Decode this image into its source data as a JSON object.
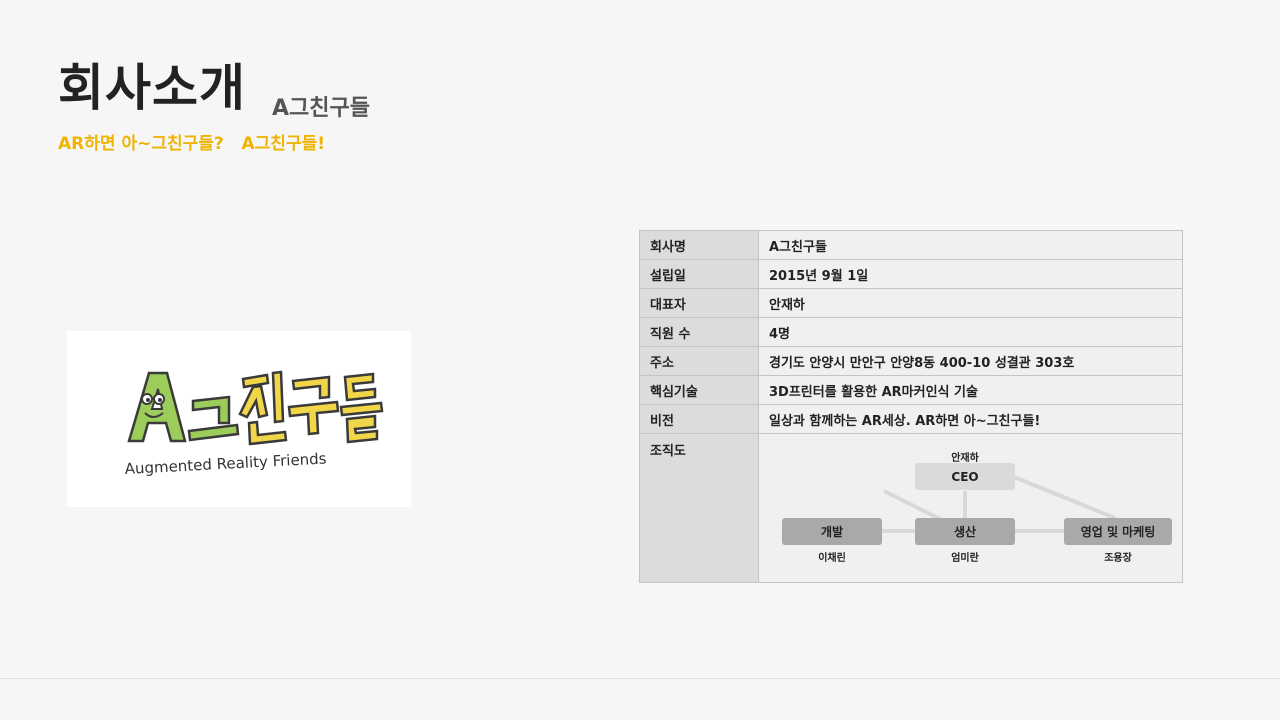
{
  "header": {
    "title": "회사소개",
    "subtitle": "A그친구들",
    "tagline": "AR하면 아~그친구들?   A그친구들!"
  },
  "logo": {
    "main_text": "A그친구들",
    "caption": "Augmented Reality Friends",
    "colors": {
      "green": "#9ccc5a",
      "yellow": "#f1d64a",
      "outline": "#3a3a3a"
    }
  },
  "company_info": {
    "rows": [
      {
        "label": "회사명",
        "value": "A그친구들"
      },
      {
        "label": "설립일",
        "value": "2015년 9월 1일"
      },
      {
        "label": "대표자",
        "value": "안재하"
      },
      {
        "label": "직원 수",
        "value": "4명"
      },
      {
        "label": "주소",
        "value": "경기도 안양시 만안구 안양8동 400-10 성결관 303호"
      },
      {
        "label": "핵심기술",
        "value": "3D프린터를 활용한 AR마커인식 기술"
      },
      {
        "label": "비전",
        "value": "일상과 함께하는 AR세상. AR하면 아~그친구들!"
      }
    ],
    "org_label": "조직도"
  },
  "org_chart": {
    "ceo": {
      "role": "CEO",
      "name": "안재하"
    },
    "teams": [
      {
        "role": "개발",
        "name": "이채린"
      },
      {
        "role": "생산",
        "name": "엄미란"
      },
      {
        "role": "영업 및 마케팅",
        "name": "조용장"
      }
    ]
  },
  "colors": {
    "background": "#f6f6f6",
    "accent": "#f0b400",
    "label_cell": "#dcdcdc",
    "value_cell": "#f0f0f0",
    "ceo_box": "#dadada",
    "team_box": "#a9a9a9"
  }
}
